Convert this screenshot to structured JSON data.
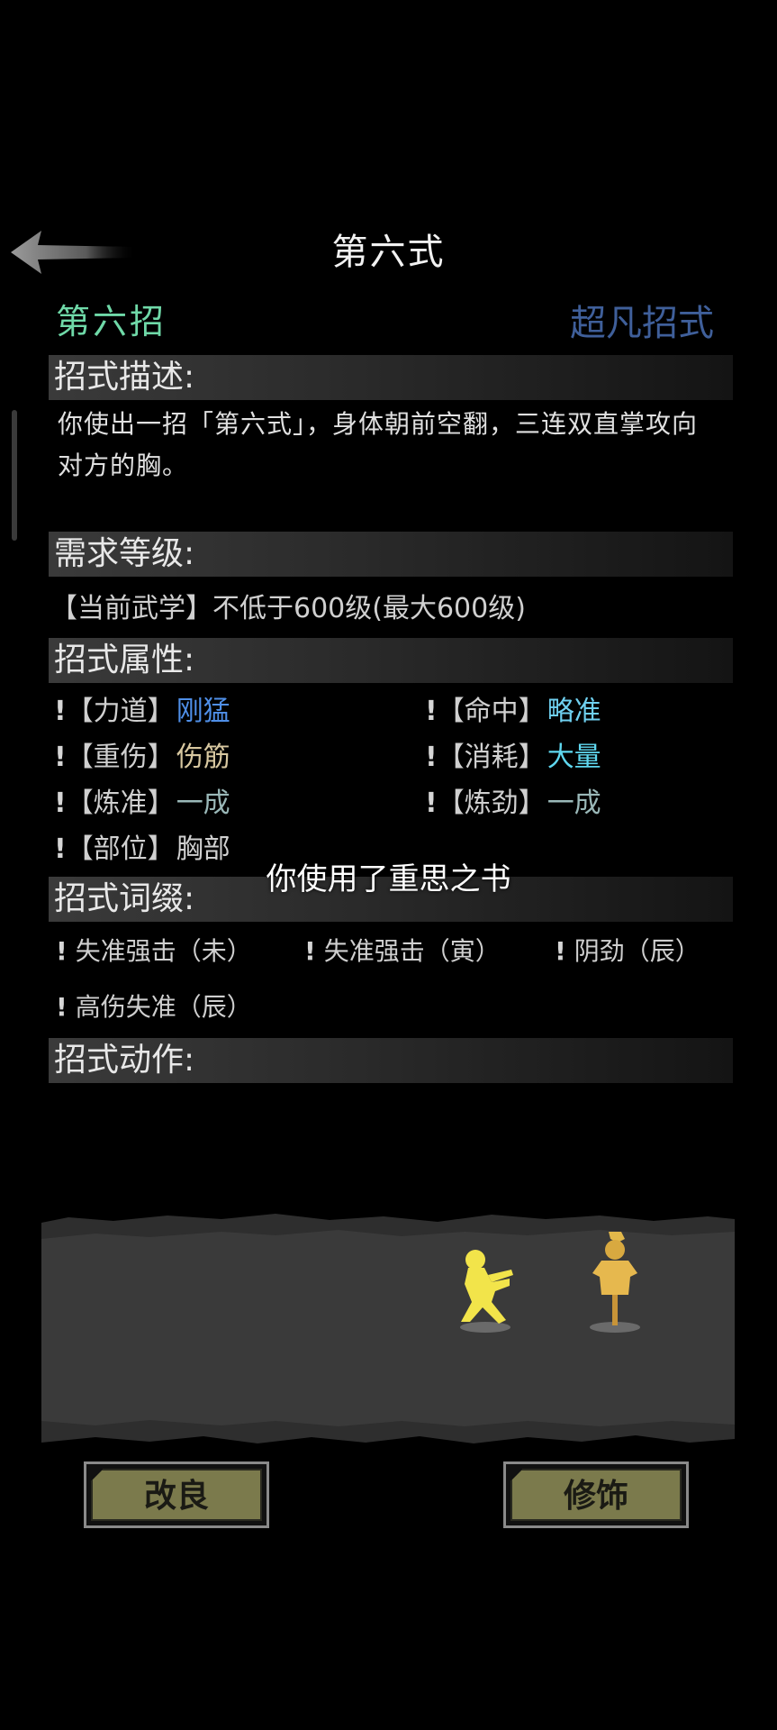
{
  "header": {
    "title": "第六式",
    "back_icon": "back-arrow-icon"
  },
  "move": {
    "name": "第六招",
    "tier": "超凡招式",
    "name_color": "#6fd9a8",
    "tier_color": "#3f5f9a"
  },
  "sections": {
    "description": "招式描述:",
    "requirement": "需求等级:",
    "attributes": "招式属性:",
    "affixes": "招式词缀:",
    "actions": "招式动作:"
  },
  "description_text": "你使出一招「第六式」，身体朝前空翻，三连双直掌攻向对方的胸。",
  "requirement_text": "【当前武学】不低于600级(最大600级)",
  "attributes": [
    {
      "bang": "!",
      "key": "【力道】",
      "value": "刚猛",
      "color": "#4f8fe8"
    },
    {
      "bang": "!",
      "key": "【命中】",
      "value": "略准",
      "color": "#6fd0f0"
    },
    {
      "bang": "!",
      "key": "【重伤】",
      "value": "伤筋",
      "color": "#d8c8a0"
    },
    {
      "bang": "!",
      "key": "【消耗】",
      "value": "大量",
      "color": "#5fd8f0"
    },
    {
      "bang": "!",
      "key": "【炼准】",
      "value": "一成",
      "color": "#9ab8b8"
    },
    {
      "bang": "!",
      "key": "【炼劲】",
      "value": "一成",
      "color": "#9ab8b8"
    },
    {
      "bang": "!",
      "key": "【部位】",
      "value": "胸部",
      "color": "#d0d0d0"
    }
  ],
  "affixes": [
    {
      "bang": "!",
      "label": "失准强击（未）"
    },
    {
      "bang": "!",
      "label": "失准强击（寅）"
    },
    {
      "bang": "!",
      "label": "阴劲（辰）"
    },
    {
      "bang": "!",
      "label": "高伤失准（辰）"
    }
  ],
  "toast": "你使用了重思之书",
  "buttons": {
    "improve": "改良",
    "decorate": "修饰"
  }
}
